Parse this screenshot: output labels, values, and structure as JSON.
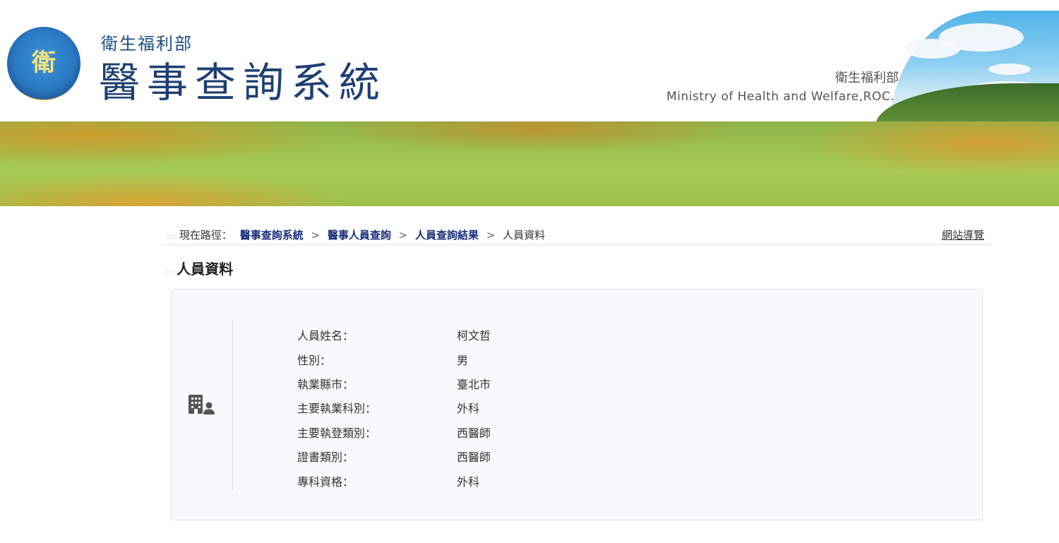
{
  "header": {
    "ministry_cn": "衛生福利部",
    "system_title": "醫事查詢系統",
    "right_ministry_cn": "衛生福利部",
    "right_ministry_en": "Ministry of Health and Welfare,ROC."
  },
  "breadcrumb": {
    "label": "現在路徑：",
    "items": [
      "醫事查詢系統",
      "醫事人員查詢",
      "人員查詢結果"
    ],
    "current": "人員資料",
    "separator": ">"
  },
  "sitemap_link": "網站導覽",
  "section_title": "人員資料",
  "info": {
    "rows": [
      {
        "label": "人員姓名：",
        "value": "柯文哲"
      },
      {
        "label": "性別：",
        "value": "男"
      },
      {
        "label": "執業縣市：",
        "value": "臺北市"
      },
      {
        "label": "主要執業科別：",
        "value": "外科"
      },
      {
        "label": "主要執登類別：",
        "value": "西醫師"
      },
      {
        "label": "證書類別：",
        "value": "西醫師"
      },
      {
        "label": "專科資格：",
        "value": "外科"
      }
    ]
  },
  "colors": {
    "title_blue": "#1f3f73",
    "link_blue": "#1a2f7c",
    "card_bg": "#f8f9fa"
  },
  "icons": {
    "logo": "ministry-emblem",
    "card": "building-user-icon"
  }
}
